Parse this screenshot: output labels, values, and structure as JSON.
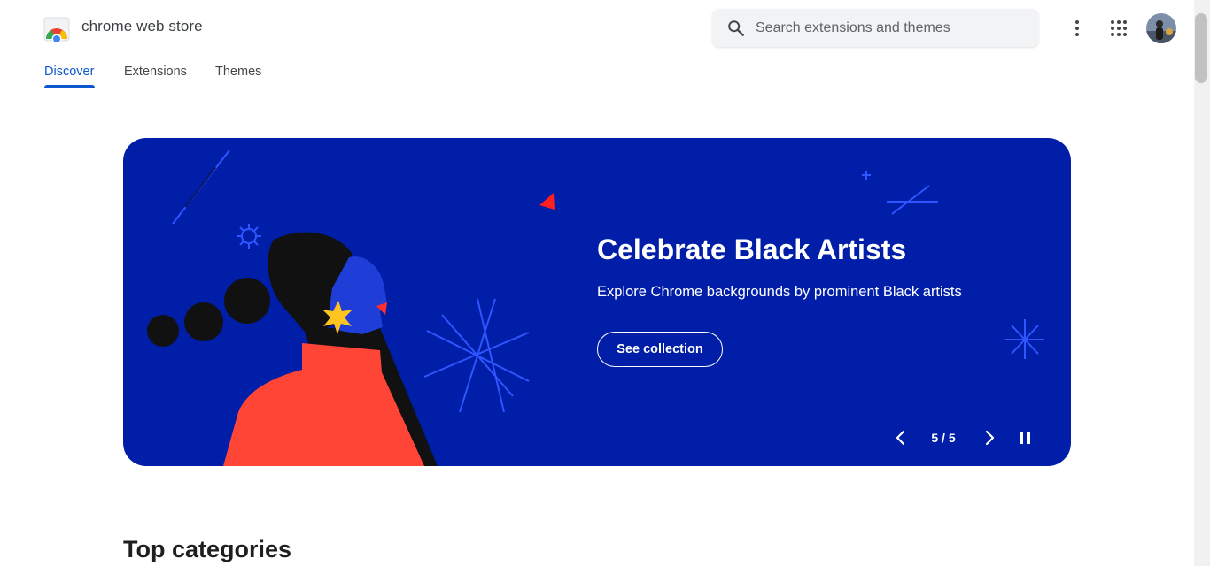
{
  "header": {
    "brand": "chrome web store",
    "search": {
      "placeholder": "Search extensions and themes",
      "value": "",
      "icon": "search-icon"
    },
    "icons": [
      "more-vert-icon",
      "apps-grid-icon",
      "avatar"
    ]
  },
  "tabs": [
    {
      "label": "Discover",
      "active": true
    },
    {
      "label": "Extensions",
      "active": false
    },
    {
      "label": "Themes",
      "active": false
    }
  ],
  "hero": {
    "title": "Celebrate Black Artists",
    "subtitle": "Explore Chrome backgrounds by prominent Black artists",
    "button_label": "See collection",
    "counter": "5 / 5",
    "controls": [
      "chevron-left-icon",
      "chevron-right-icon",
      "pause-icon"
    ]
  },
  "sections": {
    "top_categories": "Top categories"
  },
  "colors": {
    "accent": "#0b57d0",
    "hero_background": "#001ea8",
    "illustration_red": "#ff4536",
    "illustration_blue": "#1f3ed8",
    "illustration_yellow": "#ffc41f"
  }
}
